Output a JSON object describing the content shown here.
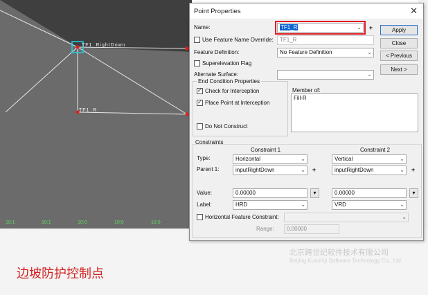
{
  "viewport": {
    "labels": [
      "TF1_RightDown",
      "TF1_R"
    ],
    "ruler": [
      "10:1",
      "10:1",
      "10:0",
      "10:0",
      "10:0"
    ]
  },
  "caption": "边坡防护控制点",
  "watermark": {
    "name": "北京跨世纪软件技术有限公司",
    "en": "Beijing Kuashiji Software Technology Co., Ltd."
  },
  "dialog": {
    "title": "Point Properties",
    "name_label": "Name:",
    "name_value": "TF1_R",
    "use_override_label": "Use Feature Name Override:",
    "override_value": "TF1_R",
    "feature_def_label": "Feature Definition:",
    "feature_def_value": "No Feature Definition",
    "superelevation_label": "Superelevation Flag",
    "alt_surface_label": "Alternate Surface:",
    "alt_surface_value": "",
    "end_condition": {
      "title": "End Condition Properties",
      "check_interception": "Check for Interception",
      "place_point": "Place Point at Interception",
      "do_not_construct": "Do Not Construct"
    },
    "member_of_label": "Member of:",
    "member_of_items": [
      "Fill-R"
    ],
    "buttons": {
      "apply": "Apply",
      "close": "Close",
      "previous": "< Previous",
      "next": "Next >"
    },
    "constraints": {
      "title": "Constraints",
      "c1_title": "Constraint 1",
      "c2_title": "Constraint 2",
      "type_label": "Type:",
      "parent_label": "Parent 1:",
      "value_label": "Value:",
      "label_label": "Label:",
      "c1": {
        "type": "Horizontal",
        "parent": "inputRightDown",
        "value": "0.00000",
        "label": "HRD"
      },
      "c2": {
        "type": "Vertical",
        "parent": "inputRightDown",
        "value": "0.00000",
        "label": "VRD"
      },
      "hfc_label": "Horizontal Feature Constraint:",
      "range_label": "Range:",
      "range_value": "0.00000"
    }
  }
}
